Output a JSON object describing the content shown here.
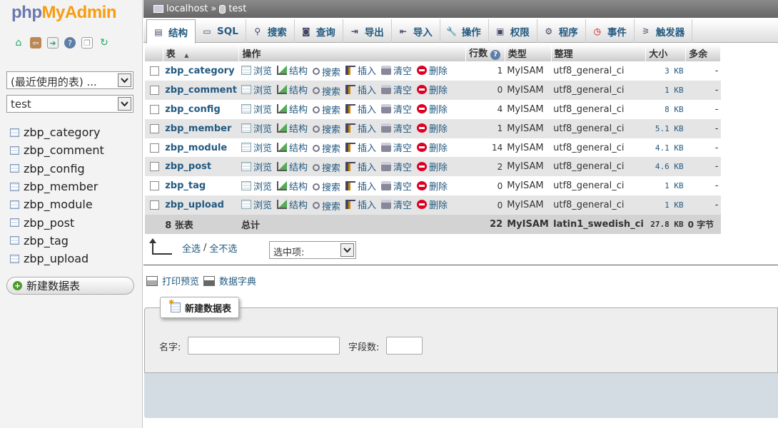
{
  "logo": {
    "part1": "php",
    "part2": "MyAdmin"
  },
  "nav": {
    "quick_icons": [
      "home-icon",
      "exit-icon",
      "sql-query-icon",
      "docs-icon",
      "copy-icon",
      "reload-icon"
    ],
    "recent_select": "(最近使用的表) ...",
    "db_select": "test",
    "tables": [
      "zbp_category",
      "zbp_comment",
      "zbp_config",
      "zbp_member",
      "zbp_module",
      "zbp_post",
      "zbp_tag",
      "zbp_upload"
    ],
    "new_table": "新建数据表"
  },
  "breadcrumb": {
    "server": "localhost",
    "sep": "»",
    "db": "test"
  },
  "tabs": [
    {
      "label": "结构",
      "icon": "structure-icon"
    },
    {
      "label": "SQL",
      "icon": "sql-icon"
    },
    {
      "label": "搜索",
      "icon": "search-icon"
    },
    {
      "label": "查询",
      "icon": "query-icon"
    },
    {
      "label": "导出",
      "icon": "export-icon"
    },
    {
      "label": "导入",
      "icon": "import-icon"
    },
    {
      "label": "操作",
      "icon": "wrench-icon"
    },
    {
      "label": "权限",
      "icon": "privileges-icon"
    },
    {
      "label": "程序",
      "icon": "routines-icon"
    },
    {
      "label": "事件",
      "icon": "events-icon"
    },
    {
      "label": "触发器",
      "icon": "triggers-icon"
    }
  ],
  "table_headers": {
    "table": "表",
    "sort": "▲",
    "action": "操作",
    "rows": "行数",
    "help": "?",
    "type": "类型",
    "collation": "整理",
    "size": "大小",
    "overhead": "多余"
  },
  "actions": {
    "browse": "浏览",
    "structure": "结构",
    "search": "搜索",
    "insert": "插入",
    "empty": "清空",
    "drop": "删除"
  },
  "rows": [
    {
      "name": "zbp_category",
      "rows": "1",
      "type": "MyISAM",
      "collation": "utf8_general_ci",
      "size": "3 KB",
      "overhead": "-"
    },
    {
      "name": "zbp_comment",
      "rows": "0",
      "type": "MyISAM",
      "collation": "utf8_general_ci",
      "size": "1 KB",
      "overhead": "-"
    },
    {
      "name": "zbp_config",
      "rows": "4",
      "type": "MyISAM",
      "collation": "utf8_general_ci",
      "size": "8 KB",
      "overhead": "-"
    },
    {
      "name": "zbp_member",
      "rows": "1",
      "type": "MyISAM",
      "collation": "utf8_general_ci",
      "size": "5.1 KB",
      "overhead": "-"
    },
    {
      "name": "zbp_module",
      "rows": "14",
      "type": "MyISAM",
      "collation": "utf8_general_ci",
      "size": "4.1 KB",
      "overhead": "-"
    },
    {
      "name": "zbp_post",
      "rows": "2",
      "type": "MyISAM",
      "collation": "utf8_general_ci",
      "size": "4.6 KB",
      "overhead": "-"
    },
    {
      "name": "zbp_tag",
      "rows": "0",
      "type": "MyISAM",
      "collation": "utf8_general_ci",
      "size": "1 KB",
      "overhead": "-"
    },
    {
      "name": "zbp_upload",
      "rows": "0",
      "type": "MyISAM",
      "collation": "utf8_general_ci",
      "size": "1 KB",
      "overhead": "-"
    }
  ],
  "totals": {
    "count": "8 张表",
    "label": "总计",
    "rows": "22",
    "type": "MyISAM",
    "collation": "latin1_swedish_ci",
    "size": "27.8 KB",
    "overhead": "0 字节"
  },
  "bulk": {
    "check_all": "全选",
    "sep": "/",
    "uncheck_all": "全不选",
    "with_selected": "选中项:"
  },
  "links": {
    "print": "打印预览",
    "dict": "数据字典"
  },
  "create": {
    "legend": "新建数据表",
    "name_label": "名字:",
    "name_value": "",
    "fields_label": "字段数:",
    "fields_value": ""
  }
}
